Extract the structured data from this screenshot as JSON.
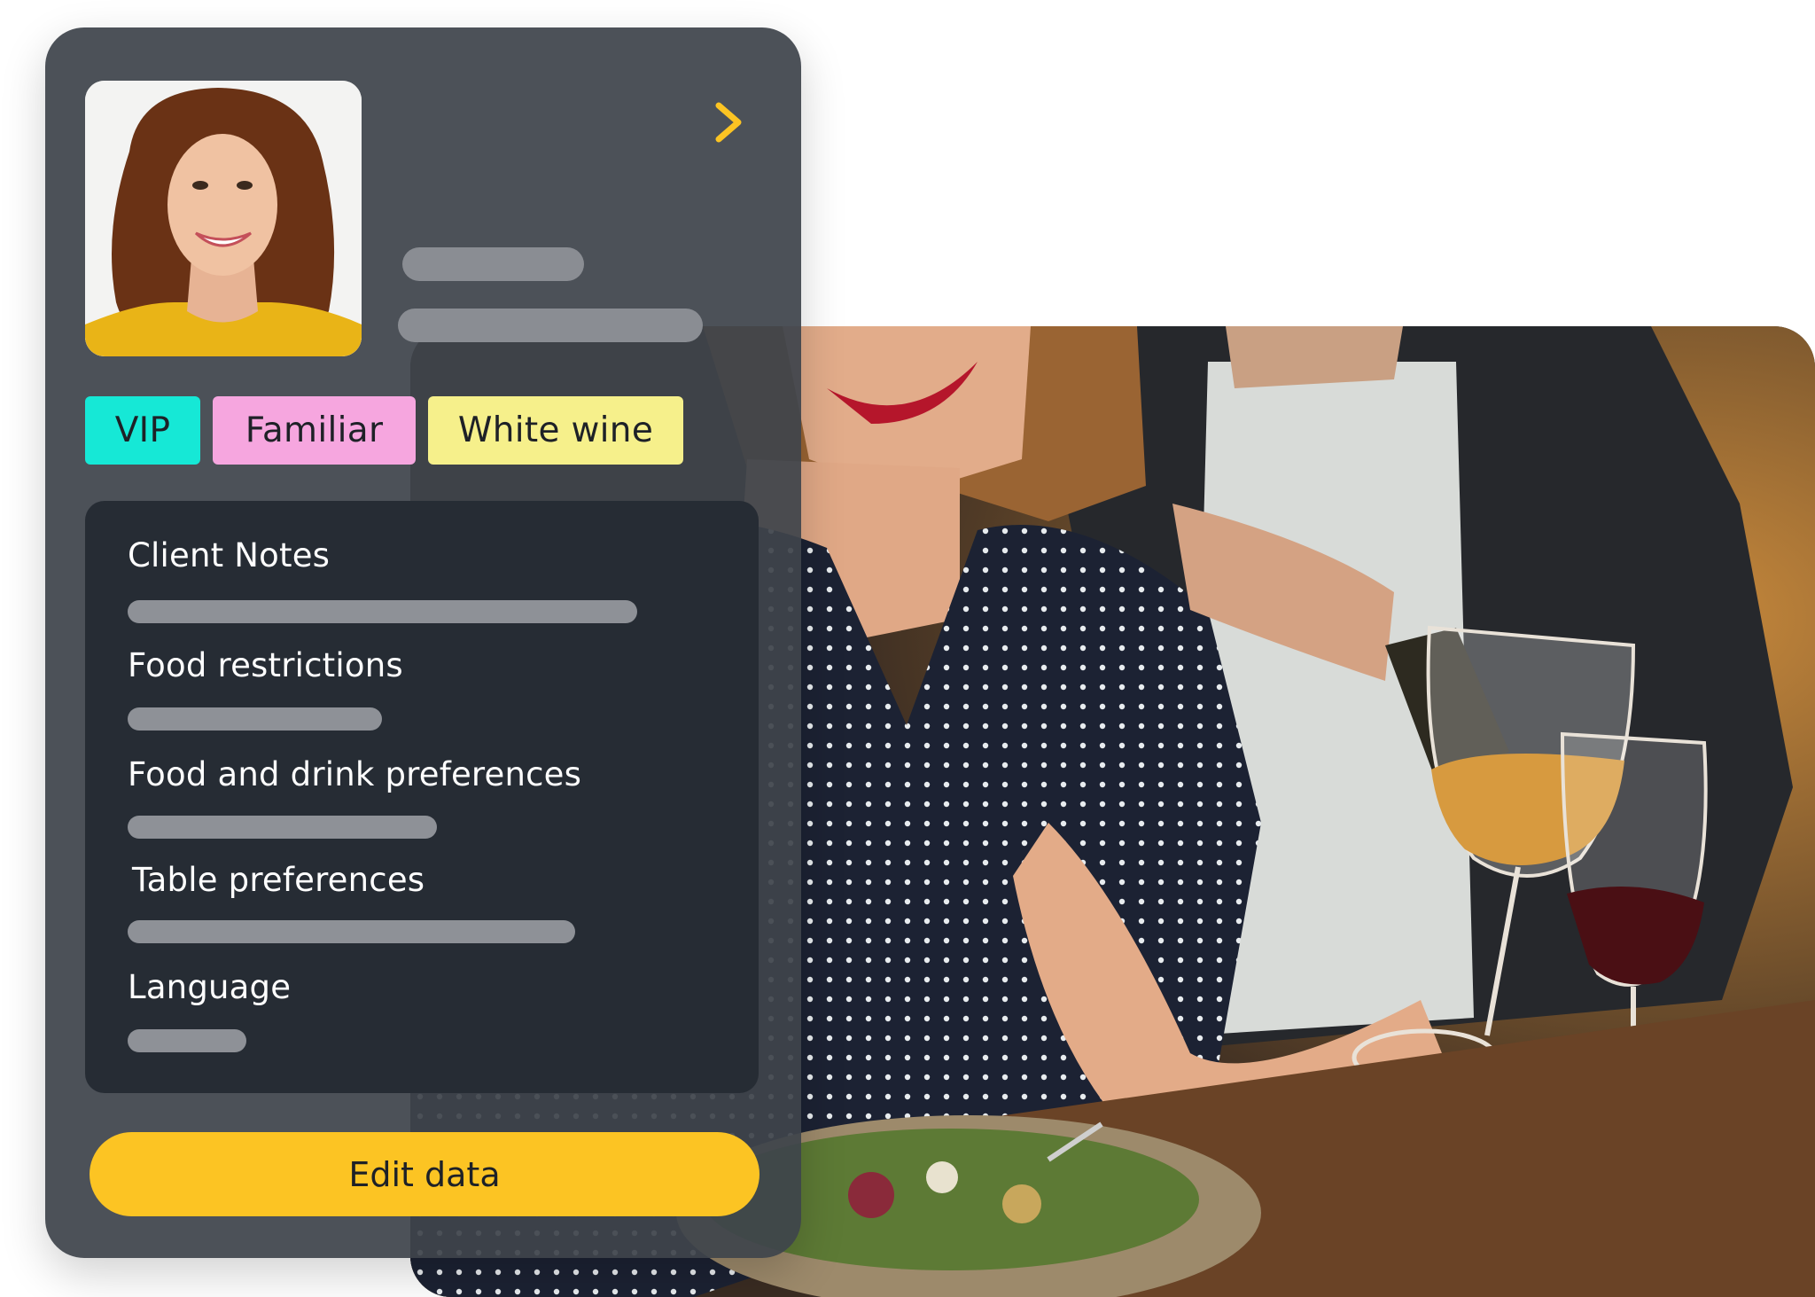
{
  "profile": {
    "next_icon": "chevron-right-icon",
    "accent_color": "#fcc423"
  },
  "tags": [
    {
      "label": "VIP",
      "color": "#16e8d6"
    },
    {
      "label": "Familiar",
      "color": "#f6a6df"
    },
    {
      "label": "White wine",
      "color": "#f6f08b"
    }
  ],
  "notes": {
    "client_notes": "Client Notes",
    "food_restrictions": "Food restrictions",
    "food_drink_preferences": "Food and drink preferences",
    "table_preferences": "Table preferences",
    "language": "Language"
  },
  "actions": {
    "edit_label": "Edit data"
  }
}
